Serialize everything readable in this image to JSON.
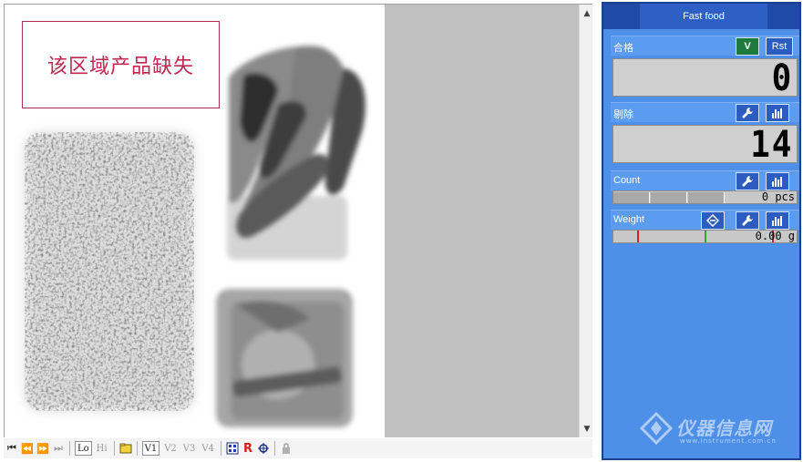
{
  "viewer": {
    "annotation": "该区域产品缺失"
  },
  "toolbar": {
    "lo": "Lo",
    "hi": "Hi",
    "v1": "V1",
    "v2": "V2",
    "v3": "V3",
    "v4": "V4",
    "r": "R"
  },
  "panel": {
    "title": "Fast food",
    "pass": {
      "label": "合格",
      "v_button": "V",
      "rst_button": "Rst",
      "value": "0"
    },
    "reject": {
      "label": "剔除",
      "value": "14"
    },
    "count": {
      "label": "Count",
      "value": "0 pcs"
    },
    "weight": {
      "label": "Weight",
      "value": "0.00 g"
    }
  },
  "watermark": {
    "text": "仪器信息网",
    "sub": "www.instrument.com.cn"
  },
  "colors": {
    "panel_bg": "#4e8fe8",
    "title_bar": "#1f4aa8",
    "annotation": "#c0284f"
  }
}
